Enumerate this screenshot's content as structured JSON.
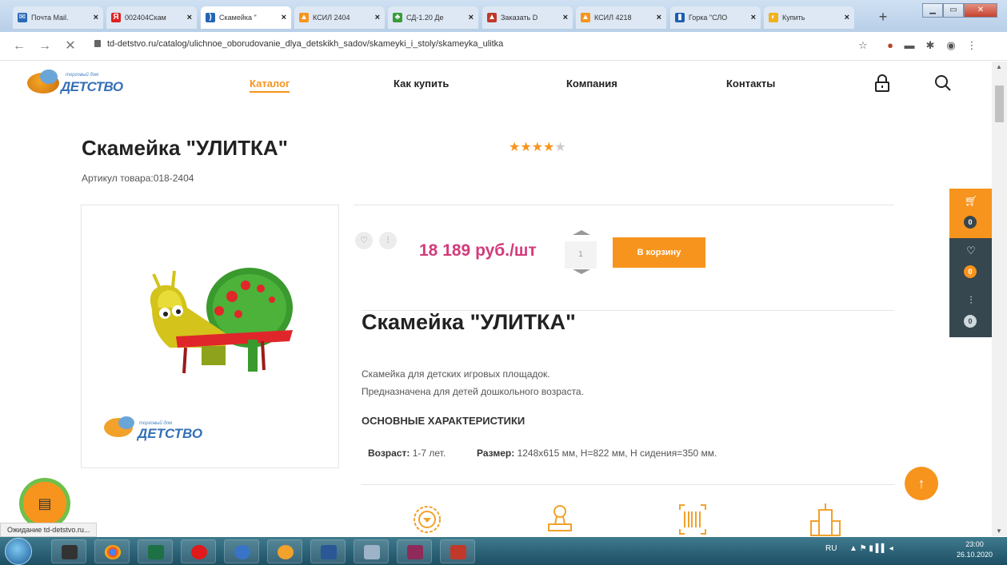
{
  "browser": {
    "tabs": [
      {
        "title": "Почта Mail.",
        "fav_color": "#2a6ab8",
        "fav_glyph": "✉",
        "active": false
      },
      {
        "title": "002404Скам",
        "fav_color": "#e02020",
        "fav_glyph": "Я",
        "active": false
      },
      {
        "title": "Скамейка \"",
        "fav_color": "#2464b4",
        "fav_glyph": ")",
        "active": true
      },
      {
        "title": "КСИЛ 2404",
        "fav_color": "#f7941d",
        "fav_glyph": "▲",
        "active": false
      },
      {
        "title": "СД-1.20 Де",
        "fav_color": "#3a9b3a",
        "fav_glyph": "♣",
        "active": false
      },
      {
        "title": "Заказать D",
        "fav_color": "#c0392b",
        "fav_glyph": "▲",
        "active": false
      },
      {
        "title": "КСИЛ 4218",
        "fav_color": "#f7941d",
        "fav_glyph": "▲",
        "active": false
      },
      {
        "title": "Горка \"СЛО",
        "fav_color": "#1d5fb0",
        "fav_glyph": "▮",
        "active": false
      },
      {
        "title": "Купить",
        "fav_color": "#f2b21b",
        "fav_glyph": "◐",
        "active": false
      }
    ],
    "tab_close": "×",
    "new_tab": "+",
    "url": "td-detstvo.ru/catalog/ulichnoe_oborudovanie_dlya_detskikh_sadov/skameyki_i_stoly/skameyka_ulitka",
    "status": "Ожидание td-detstvo.ru..."
  },
  "site": {
    "logo_small": "торговый дом",
    "logo_big": "ДЕТСТВО",
    "menu": [
      "Каталог",
      "Как купить",
      "Компания",
      "Контакты"
    ],
    "accent_color": "#f7941d",
    "price_color": "#d23b7c",
    "panel_color": "#37474f"
  },
  "product": {
    "title": "Скамейка \"УЛИТКА\"",
    "sku": "Артикул товара:018-2404",
    "rating": 4,
    "rating_max": 5,
    "price": "18 189 руб./шт",
    "qty": "1",
    "cart_button": "В корзину",
    "title2": "Скамейка \"УЛИТКА\"",
    "desc1": "Скамейка для детских игровых площадок.",
    "desc2": "Предназначена для детей дошкольного возраста.",
    "specs_heading": "ОСНОВНЫЕ ХАРАКТЕРИСТИКИ",
    "age_label": "Возраст:",
    "age_value": "1-7 лет.",
    "size_label": "Размер:",
    "size_value": "1248х615 мм, Н=822 мм, Н сидения=350 мм."
  },
  "side_panel": {
    "cart_count": "0",
    "fav_count": "0",
    "compare_count": "0"
  },
  "taskbar": {
    "lang": "RU",
    "time": "23:00",
    "date": "26.10.2020"
  }
}
